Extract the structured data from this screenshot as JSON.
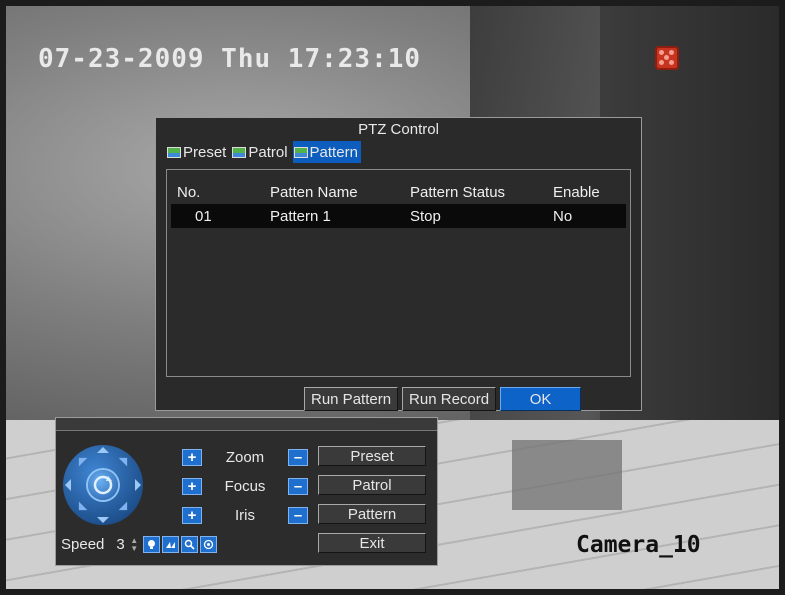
{
  "osd": {
    "timestamp": "07-23-2009 Thu 17:23:10",
    "camera_label": "Camera_10",
    "record_icon": "record-indicator-icon"
  },
  "ptz_dialog": {
    "title": "PTZ Control",
    "tabs": [
      {
        "label": "Preset",
        "icon": "image-icon",
        "active": false
      },
      {
        "label": "Patrol",
        "icon": "image-icon",
        "active": false
      },
      {
        "label": "Pattern",
        "icon": "image-icon",
        "active": true
      }
    ],
    "table": {
      "headers": [
        "No.",
        "Patten Name",
        "Pattern Status",
        "Enable"
      ],
      "rows": [
        [
          "01",
          "Pattern 1",
          "Stop",
          "No"
        ]
      ]
    },
    "buttons": {
      "run_pattern": "Run Pattern",
      "run_record": "Run Record",
      "ok": "OK"
    }
  },
  "ptz_panel": {
    "controls": [
      {
        "label": "Zoom",
        "plus": "+",
        "minus": "–"
      },
      {
        "label": "Focus",
        "plus": "+",
        "minus": "–"
      },
      {
        "label": "Iris",
        "plus": "+",
        "minus": "–"
      }
    ],
    "side_buttons": [
      "Preset",
      "Patrol",
      "Pattern",
      "Exit"
    ],
    "speed_label": "Speed",
    "speed_value": "3",
    "tool_icons": [
      "light-icon",
      "wiper-icon",
      "zoom-area-icon",
      "auto-scan-icon"
    ]
  },
  "colors": {
    "accent": "#0c5dbd",
    "dialog_bg": "#2a2a2a",
    "text": "#e8e8e8",
    "record": "#c83420"
  }
}
